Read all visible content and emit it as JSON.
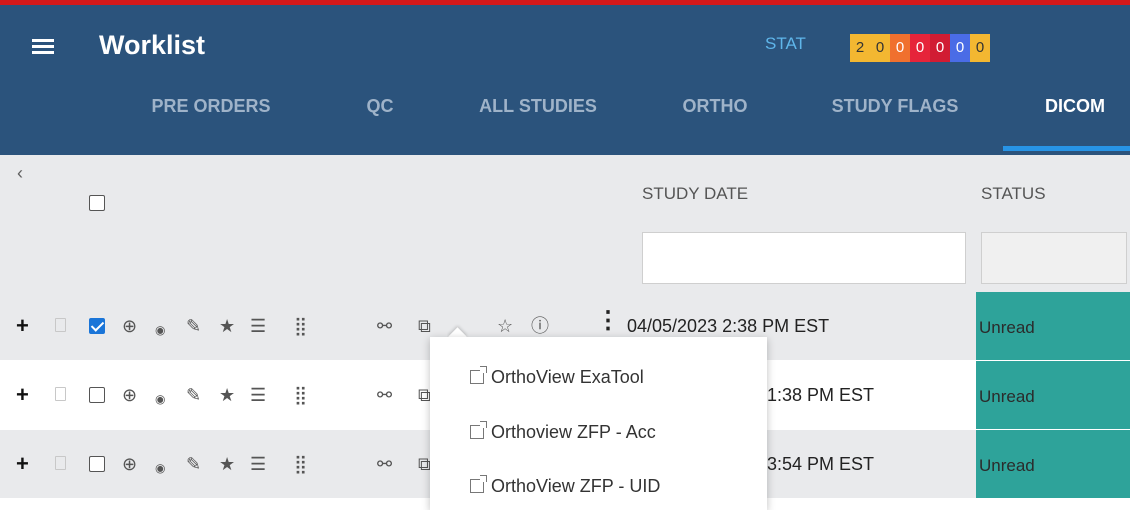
{
  "header": {
    "title": "Worklist",
    "stat_label": "STAT",
    "stat_counts": [
      {
        "value": "2",
        "color": "#f3b731",
        "text_color": "#333333"
      },
      {
        "value": "0",
        "color": "#f3b731",
        "text_color": "#333333"
      },
      {
        "value": "0",
        "color": "#f0702e",
        "text_color": "#ffffff"
      },
      {
        "value": "0",
        "color": "#e6243a",
        "text_color": "#ffffff"
      },
      {
        "value": "0",
        "color": "#d11c33",
        "text_color": "#ffffff"
      },
      {
        "value": "0",
        "color": "#4a6ce6",
        "text_color": "#ffffff"
      },
      {
        "value": "0",
        "color": "#f3b731",
        "text_color": "#333333"
      }
    ]
  },
  "tabs": [
    {
      "label": "PRE ORDERS",
      "active": false
    },
    {
      "label": "QC",
      "active": false
    },
    {
      "label": "ALL STUDIES",
      "active": false
    },
    {
      "label": "ORTHO",
      "active": false
    },
    {
      "label": "STUDY FLAGS",
      "active": false
    },
    {
      "label": "DICOM",
      "active": true
    }
  ],
  "grid": {
    "columns": {
      "study_date": "STUDY DATE",
      "status": "STATUS"
    },
    "filters": {
      "study_date": "",
      "status": ""
    }
  },
  "rows": [
    {
      "checked": true,
      "study_date": "04/05/2023 2:38 PM EST",
      "status": "Unread"
    },
    {
      "checked": false,
      "study_date": "1:38 PM EST",
      "status": "Unread"
    },
    {
      "checked": false,
      "study_date": "3:54 PM EST",
      "status": "Unread"
    }
  ],
  "popup": {
    "items": [
      "OrthoView ExaTool",
      "Orthoview ZFP - Acc",
      "OrthoView ZFP - UID"
    ]
  },
  "colors": {
    "header_bg": "#2b537c",
    "accent_red": "#d4191b",
    "tab_underline": "#2794e6",
    "status_unread": "#2ea39a"
  },
  "icons": {
    "menu": "hamburger-icon",
    "collapse": "chevron-left-icon",
    "row_icons": [
      "plus-icon",
      "document-icon",
      "globe-icon",
      "eye-icon",
      "pencil-icon",
      "star-icon",
      "report-icon",
      "grid-icon",
      "link-icon",
      "external-link-icon",
      "star-outline-icon",
      "info-icon",
      "more-vertical-icon"
    ]
  }
}
